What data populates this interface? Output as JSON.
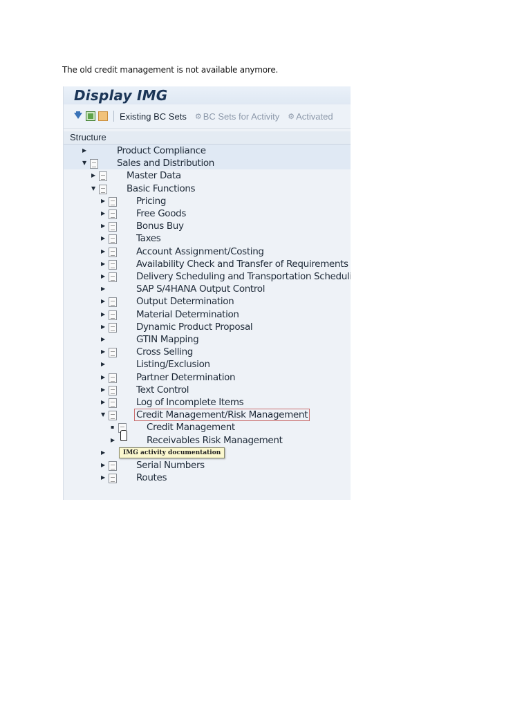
{
  "caption": "The old credit management is not available anymore.",
  "window": {
    "title": "Display IMG"
  },
  "toolbar": {
    "existing_bc_sets": "Existing BC Sets",
    "bc_sets_for_activity": "BC Sets for Activity",
    "activated": "Activated"
  },
  "structure": {
    "header": "Structure",
    "items": [
      {
        "label": "Product Compliance",
        "level": 0,
        "arrow": "collapsed",
        "doc": false
      },
      {
        "label": "Sales and Distribution",
        "level": 0,
        "arrow": "expanded",
        "doc": true
      },
      {
        "label": "Master Data",
        "level": 1,
        "arrow": "collapsed",
        "doc": true
      },
      {
        "label": "Basic Functions",
        "level": 1,
        "arrow": "expanded",
        "doc": true
      },
      {
        "label": "Pricing",
        "level": 2,
        "arrow": "collapsed",
        "doc": true
      },
      {
        "label": "Free Goods",
        "level": 2,
        "arrow": "collapsed",
        "doc": true
      },
      {
        "label": "Bonus Buy",
        "level": 2,
        "arrow": "collapsed",
        "doc": true
      },
      {
        "label": "Taxes",
        "level": 2,
        "arrow": "collapsed",
        "doc": true
      },
      {
        "label": "Account Assignment/Costing",
        "level": 2,
        "arrow": "collapsed",
        "doc": true
      },
      {
        "label": "Availability Check and Transfer of Requirements",
        "level": 2,
        "arrow": "collapsed",
        "doc": true
      },
      {
        "label": "Delivery Scheduling and Transportation Scheduling",
        "level": 2,
        "arrow": "collapsed",
        "doc": true
      },
      {
        "label": "SAP S/4HANA Output Control",
        "level": 2,
        "arrow": "collapsed",
        "doc": false
      },
      {
        "label": "Output Determination",
        "level": 2,
        "arrow": "collapsed",
        "doc": true
      },
      {
        "label": "Material Determination",
        "level": 2,
        "arrow": "collapsed",
        "doc": true
      },
      {
        "label": "Dynamic Product Proposal",
        "level": 2,
        "arrow": "collapsed",
        "doc": true
      },
      {
        "label": "GTIN Mapping",
        "level": 2,
        "arrow": "collapsed",
        "doc": false
      },
      {
        "label": "Cross Selling",
        "level": 2,
        "arrow": "collapsed",
        "doc": true
      },
      {
        "label": "Listing/Exclusion",
        "level": 2,
        "arrow": "collapsed",
        "doc": false
      },
      {
        "label": "Partner Determination",
        "level": 2,
        "arrow": "collapsed",
        "doc": true
      },
      {
        "label": "Text Control",
        "level": 2,
        "arrow": "collapsed",
        "doc": true
      },
      {
        "label": "Log of Incomplete Items",
        "level": 2,
        "arrow": "collapsed",
        "doc": true
      },
      {
        "label": "Credit Management/Risk Management",
        "level": 2,
        "arrow": "expanded",
        "doc": true,
        "boxed": true
      },
      {
        "label": "Credit Management",
        "level": 3,
        "arrow": "leaf",
        "doc": true
      },
      {
        "label": "Receivables Risk Management",
        "level": 3,
        "arrow": "collapsed",
        "doc": false
      },
      {
        "label": "",
        "level": 2,
        "arrow": "collapsed",
        "doc": false
      },
      {
        "label": "Serial Numbers",
        "level": 2,
        "arrow": "collapsed",
        "doc": true
      },
      {
        "label": "Routes",
        "level": 2,
        "arrow": "collapsed",
        "doc": true
      }
    ]
  },
  "tooltip": "IMG activity documentation",
  "icons": {
    "filter": "filter-icon",
    "doc": "img-documentation-icon"
  }
}
